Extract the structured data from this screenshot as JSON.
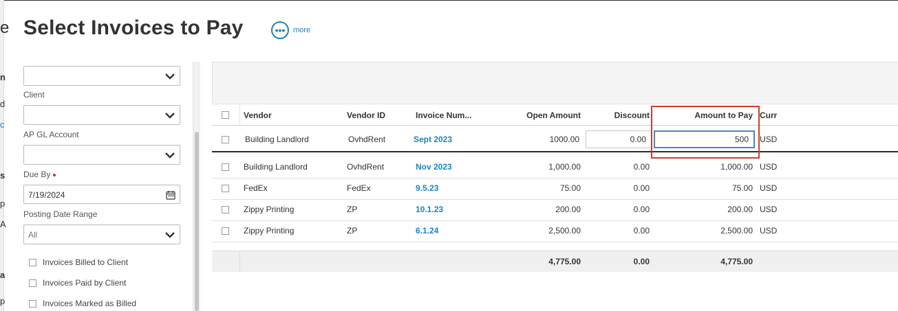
{
  "background_peek": [
    "e",
    "n",
    "d",
    "c",
    "s",
    "p",
    "A",
    "a",
    "p"
  ],
  "header": {
    "title": "Select Invoices to Pay",
    "more_label": "more"
  },
  "filters": {
    "top_select_value": "",
    "client_label": "Client",
    "client_value": "",
    "ap_gl_label": "AP GL Account",
    "ap_gl_value": "",
    "due_by_label": "Due By",
    "due_by_value": "7/19/2024",
    "posting_range_label": "Posting Date Range",
    "posting_range_value": "All",
    "checkboxes": [
      {
        "label": "Invoices Billed to Client",
        "checked": false
      },
      {
        "label": "Invoices Paid by Client",
        "checked": false
      },
      {
        "label": "Invoices Marked as Billed",
        "checked": false
      }
    ]
  },
  "grid": {
    "columns": [
      "Vendor",
      "Vendor ID",
      "Invoice Num...",
      "Open Amount",
      "Discount",
      "Amount to Pay",
      "Curr"
    ],
    "editing_row": {
      "vendor": "Building Landlord",
      "vendor_id": "OvhdRent",
      "invoice": "Sept 2023",
      "open_amount": "1000.00",
      "discount": "0.00",
      "amount_to_pay": "500",
      "curr": "USD"
    },
    "rows": [
      {
        "vendor": "Building Landlord",
        "vendor_id": "OvhdRent",
        "invoice": "Nov 2023",
        "open_amount": "1,000.00",
        "discount": "0.00",
        "amount_to_pay": "1,000.00",
        "curr": "USD"
      },
      {
        "vendor": "FedEx",
        "vendor_id": "FedEx",
        "invoice": "9.5.23",
        "open_amount": "75.00",
        "discount": "0.00",
        "amount_to_pay": "75.00",
        "curr": "USD"
      },
      {
        "vendor": "Zippy Printing",
        "vendor_id": "ZP",
        "invoice": "10.1.23",
        "open_amount": "200.00",
        "discount": "0.00",
        "amount_to_pay": "200.00",
        "curr": "USD"
      },
      {
        "vendor": "Zippy Printing",
        "vendor_id": "ZP",
        "invoice": "6.1.24",
        "open_amount": "2,500.00",
        "discount": "0.00",
        "amount_to_pay": "2,500.00",
        "curr": "USD"
      }
    ],
    "totals": {
      "open_amount": "4,775.00",
      "discount": "0.00",
      "amount_to_pay": "4,775.00"
    }
  },
  "colors": {
    "accent": "#1a84c6",
    "highlight": "#d43a2a",
    "required": "#c0392b"
  }
}
